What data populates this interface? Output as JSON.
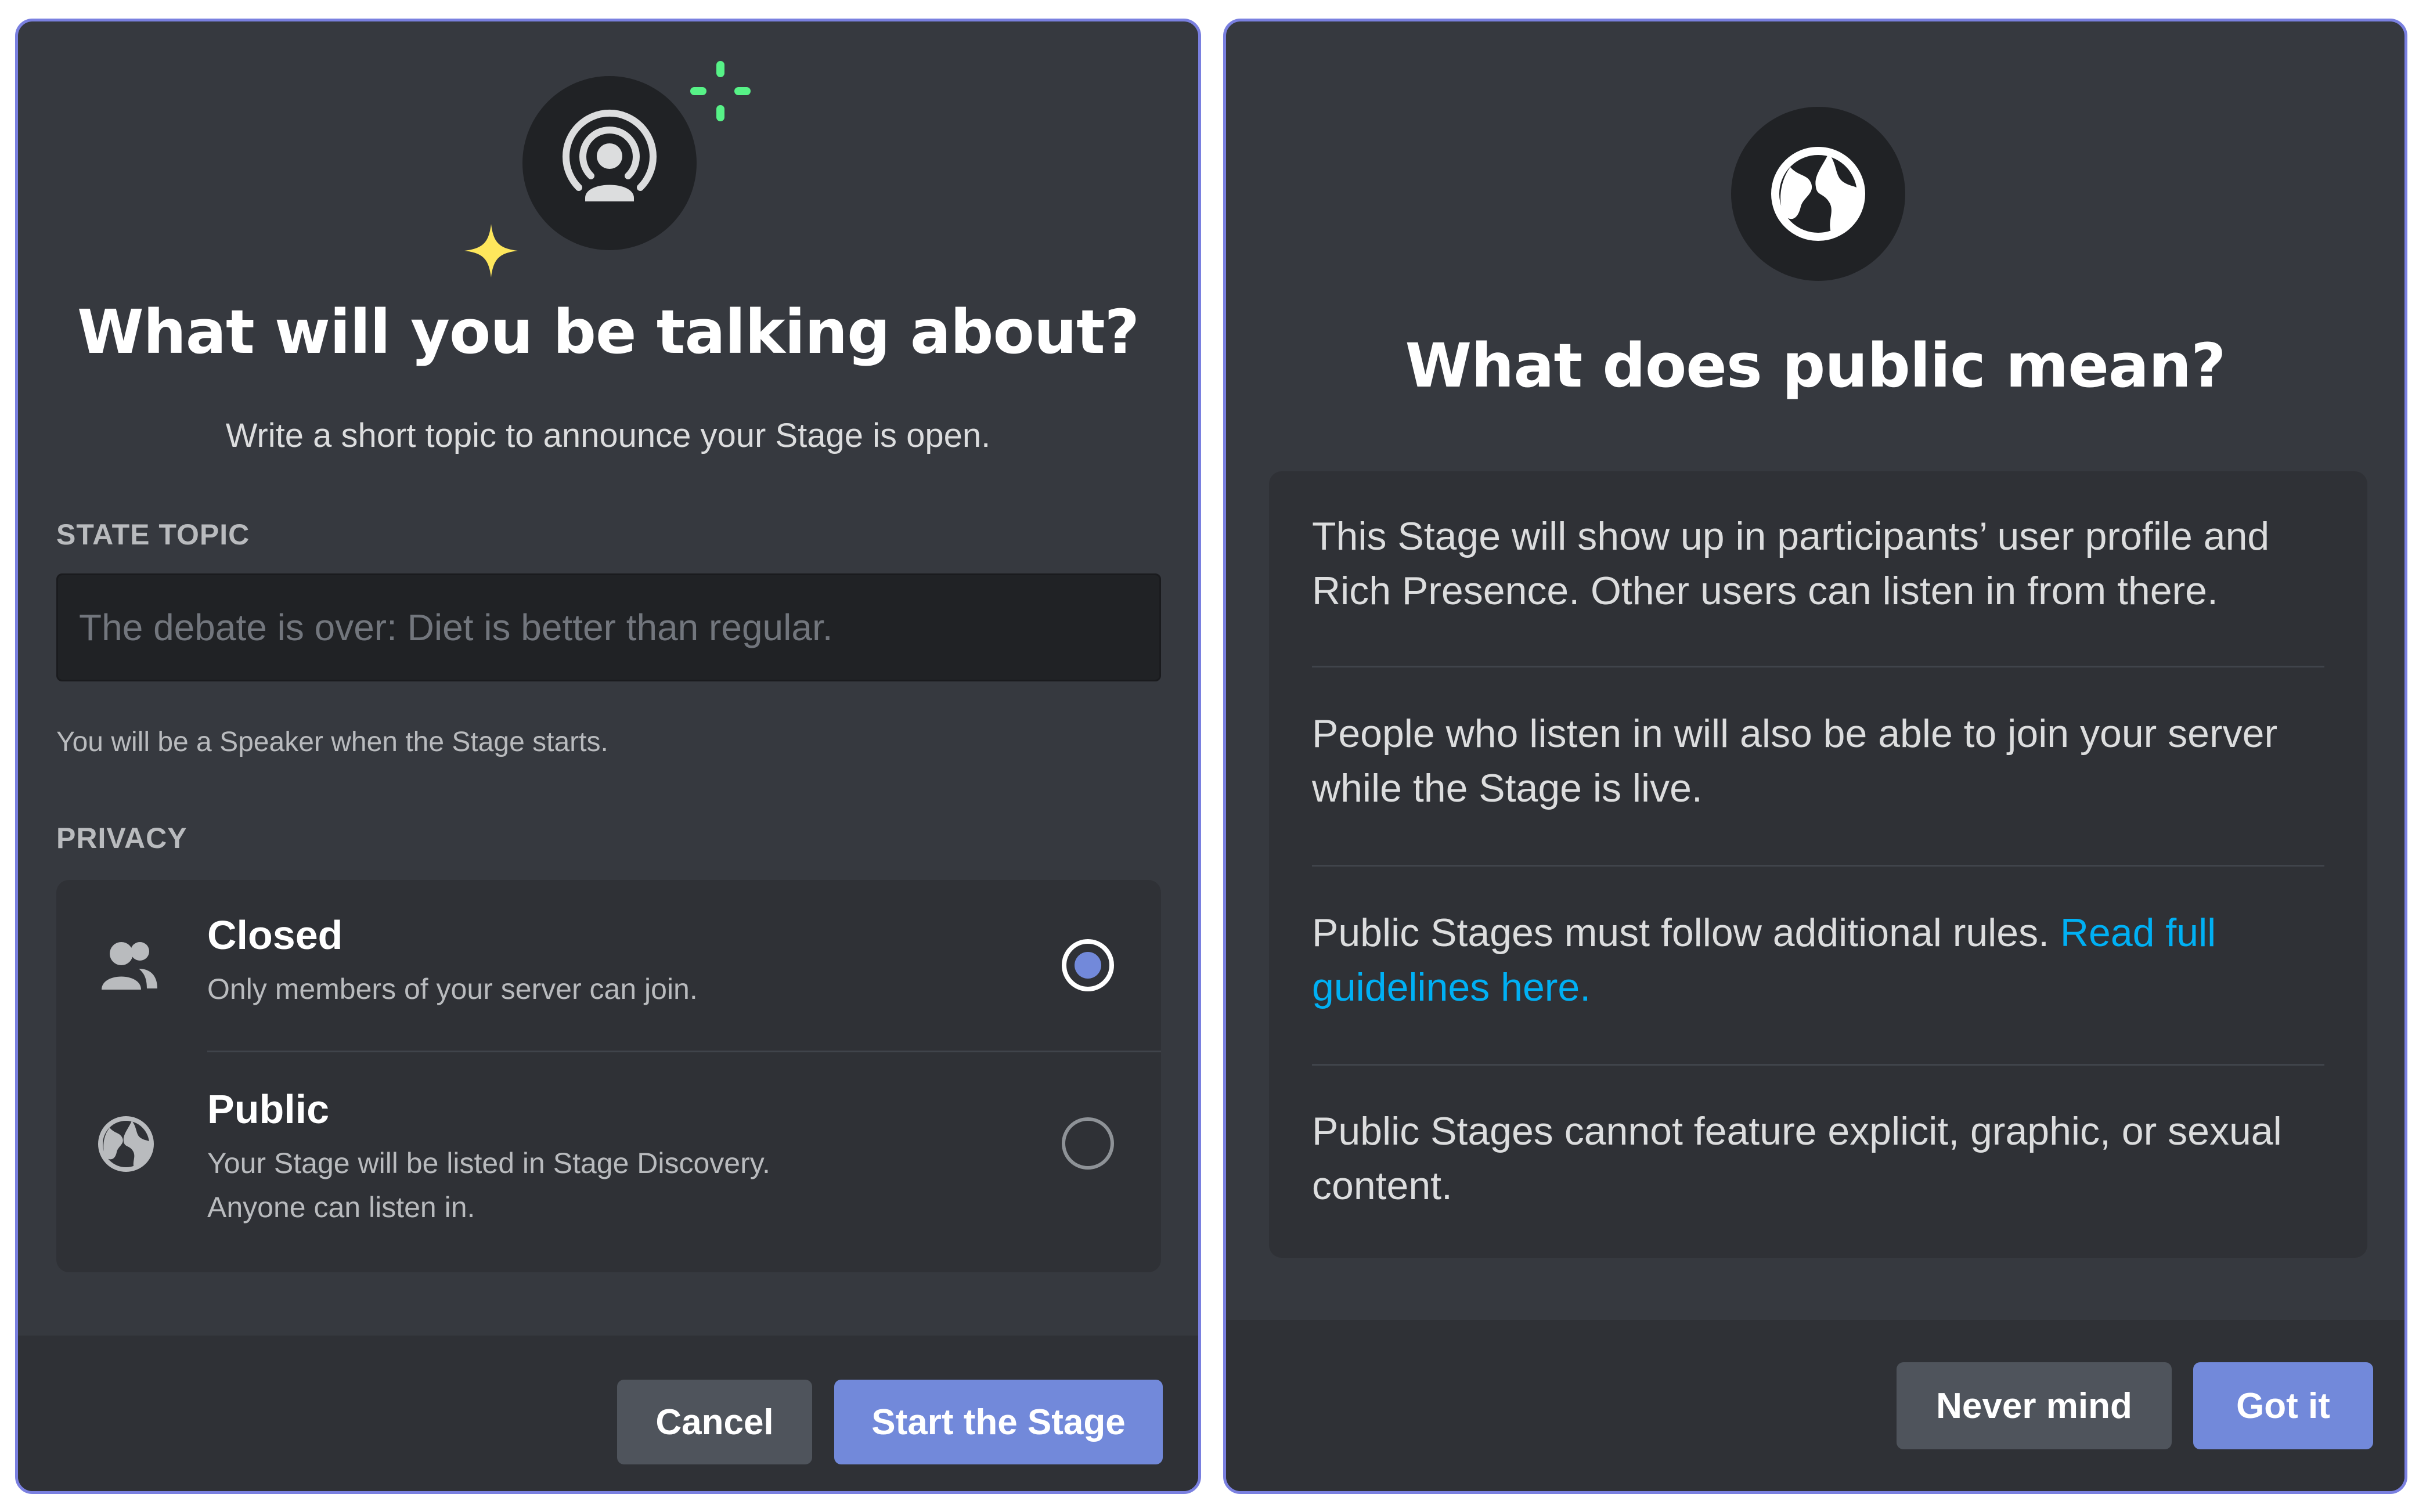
{
  "left_modal": {
    "title": "What will you be talking about?",
    "subtitle": "Write a short topic to announce your Stage is open.",
    "topic_label": "STATE TOPIC",
    "topic_input": {
      "value": "",
      "placeholder": "The debate is over: Diet is better than regular."
    },
    "topic_hint": "You will be a Speaker when the Stage starts.",
    "privacy_label": "PRIVACY",
    "privacy_options": [
      {
        "title": "Closed",
        "description": "Only members of your server can join.",
        "icon": "members-icon",
        "selected": true
      },
      {
        "title": "Public",
        "description": "Your Stage will be listed in Stage Discovery. Anyone can listen in.",
        "icon": "globe-icon",
        "selected": false
      }
    ],
    "buttons": {
      "cancel": "Cancel",
      "start": "Start the Stage"
    },
    "icon": "stage-broadcast-icon"
  },
  "right_modal": {
    "title": "What does public mean?",
    "icon": "globe-icon",
    "items": [
      {
        "text": "This Stage will show up in participants’ user profile and Rich Presence. Other users can listen in from there."
      },
      {
        "text": "People who listen in will also be able to join your server while the Stage is live."
      },
      {
        "text": "Public Stages must follow additional rules.",
        "link": "Read full guidelines here."
      },
      {
        "text": "Public Stages cannot feature explicit, graphic, or sexual content."
      }
    ],
    "buttons": {
      "never_mind": "Never mind",
      "got_it": "Got it"
    }
  },
  "colors": {
    "modal_bg": "#36393f",
    "footer_bg": "#2f3136",
    "input_bg": "#202225",
    "accent": "#7289da",
    "link": "#00b0f4",
    "sparkle_yellow": "#fee75c",
    "sparkle_green": "#57f287",
    "modal_border": "#7a80e0"
  }
}
